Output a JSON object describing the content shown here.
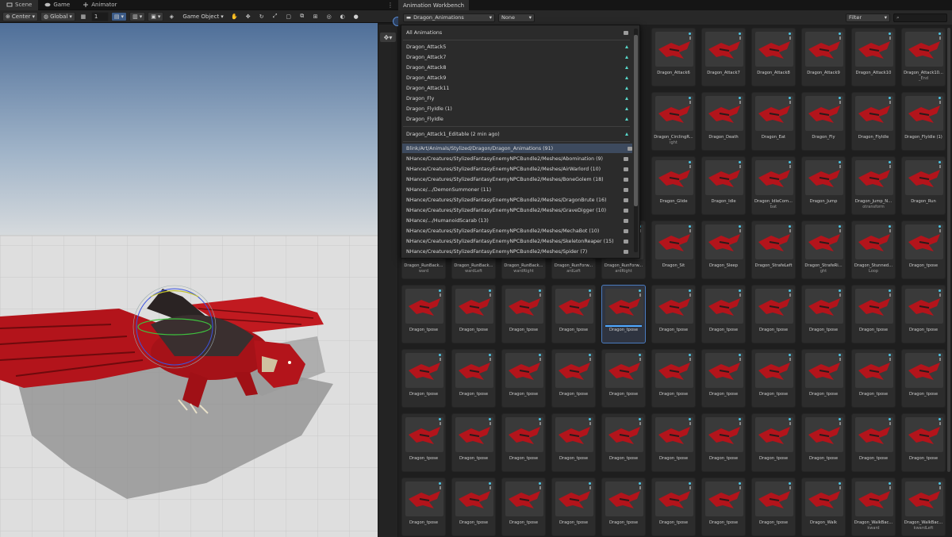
{
  "scene_tabs": [
    {
      "label": "Scene",
      "icon": "scene-icon"
    },
    {
      "label": "Game",
      "icon": "game-icon"
    },
    {
      "label": "Animator",
      "icon": "animator-icon"
    }
  ],
  "toolbar": {
    "pivot": "Center",
    "space": "Global",
    "snap": "1",
    "view_mode": "Game Object"
  },
  "workbench": {
    "title": "Animation Workbench",
    "folder_dropdown": "Dragon_Animations",
    "none_dropdown": "None",
    "filter_label": "Filter",
    "popup": {
      "all_animations": "All Animations",
      "recent": [
        "Dragon_Attack5",
        "Dragon_Attack7",
        "Dragon_Attack8",
        "Dragon_Attack9",
        "Dragon_Attack11",
        "Dragon_Fly",
        "Dragon_FlyIdle (1)",
        "Dragon_FlyIdle"
      ],
      "editable": "Dragon_Attack1_Editable  (2 min ago)",
      "folders": [
        "Blink/Art/Animals/Stylized/Dragon/Dragon_Animations  (91)",
        "NHance/Creatures/StylizedFantasyEnemyNPCBundle2/Meshes/Abomination  (9)",
        "NHance/Creatures/StylizedFantasyEnemyNPCBundle2/Meshes/AirWarlord  (10)",
        "NHance/Creatures/StylizedFantasyEnemyNPCBundle2/Meshes/BoneGolem  (18)",
        "NHance/.../DemonSummoner  (11)",
        "NHance/Creatures/StylizedFantasyEnemyNPCBundle2/Meshes/DragonBrute  (16)",
        "NHance/Creatures/StylizedFantasyEnemyNPCBundle2/Meshes/GraveDigger  (10)",
        "NHance/.../HumanoidScarab  (13)",
        "NHance/Creatures/StylizedFantasyEnemyNPCBundle2/Meshes/MechaBot  (10)",
        "NHance/Creatures/StylizedFantasyEnemyNPCBundle2/Meshes/SkeletonReaper  (15)",
        "NHance/Creatures/StylizedFantasyEnemyNPCBundle2/Meshes/Spider  (7)"
      ]
    },
    "rows": [
      [
        {
          "n": "Dragon_Attack6",
          "s": ""
        },
        {
          "n": "Dragon_Attack7",
          "s": ""
        },
        {
          "n": "Dragon_Attack8",
          "s": ""
        },
        {
          "n": "Dragon_Attack9",
          "s": ""
        },
        {
          "n": "Dragon_Attack10",
          "s": ""
        },
        {
          "n": "Dragon_Attack10...",
          "s": "_End"
        }
      ],
      [
        {
          "n": "Dragon_CirclingR...",
          "s": "ight"
        },
        {
          "n": "Dragon_Death",
          "s": ""
        },
        {
          "n": "Dragon_Eat",
          "s": ""
        },
        {
          "n": "Dragon_Fly",
          "s": ""
        },
        {
          "n": "Dragon_FlyIdle",
          "s": ""
        },
        {
          "n": "Dragon_FlyIdle (1)",
          "s": ""
        }
      ],
      [
        {
          "n": "Dragon_Glide",
          "s": ""
        },
        {
          "n": "Dragon_Idle",
          "s": ""
        },
        {
          "n": "Dragon_IdleCom...",
          "s": "bat"
        },
        {
          "n": "Dragon_Jump",
          "s": ""
        },
        {
          "n": "Dragon_Jump_N...",
          "s": "otransform"
        },
        {
          "n": "Dragon_Run",
          "s": ""
        }
      ],
      [
        {
          "n": "Dragon_RunBack...",
          "s": "ward"
        },
        {
          "n": "Dragon_RunBack...",
          "s": "wardLeft"
        },
        {
          "n": "Dragon_RunBack...",
          "s": "wardRight"
        },
        {
          "n": "Dragon_RunForw...",
          "s": "ardLeft"
        },
        {
          "n": "Dragon_RunForw...",
          "s": "ardRight"
        },
        {
          "n": "Dragon_Sit",
          "s": ""
        },
        {
          "n": "Dragon_Sleep",
          "s": ""
        },
        {
          "n": "Dragon_StrafeLeft",
          "s": ""
        },
        {
          "n": "Dragon_StrafeRi...",
          "s": "ght"
        },
        {
          "n": "Dragon_Stunned...",
          "s": "Loop"
        },
        {
          "n": "Dragon_tpose",
          "s": ""
        }
      ],
      [
        {
          "n": "Dragon_tpose",
          "s": ""
        },
        {
          "n": "Dragon_tpose",
          "s": ""
        },
        {
          "n": "Dragon_tpose",
          "s": ""
        },
        {
          "n": "Dragon_tpose",
          "s": ""
        },
        {
          "n": "Dragon_tpose",
          "s": ""
        },
        {
          "n": "Dragon_tpose",
          "s": ""
        },
        {
          "n": "Dragon_tpose",
          "s": ""
        },
        {
          "n": "Dragon_tpose",
          "s": ""
        },
        {
          "n": "Dragon_tpose",
          "s": ""
        },
        {
          "n": "Dragon_tpose",
          "s": ""
        },
        {
          "n": "Dragon_tpose",
          "s": ""
        }
      ],
      [
        {
          "n": "Dragon_tpose",
          "s": ""
        },
        {
          "n": "Dragon_tpose",
          "s": ""
        },
        {
          "n": "Dragon_tpose",
          "s": ""
        },
        {
          "n": "Dragon_tpose",
          "s": ""
        },
        {
          "n": "Dragon_tpose",
          "s": ""
        },
        {
          "n": "Dragon_tpose",
          "s": ""
        },
        {
          "n": "Dragon_tpose",
          "s": ""
        },
        {
          "n": "Dragon_tpose",
          "s": ""
        },
        {
          "n": "Dragon_tpose",
          "s": ""
        },
        {
          "n": "Dragon_tpose",
          "s": ""
        },
        {
          "n": "Dragon_tpose",
          "s": ""
        }
      ],
      [
        {
          "n": "Dragon_tpose",
          "s": ""
        },
        {
          "n": "Dragon_tpose",
          "s": ""
        },
        {
          "n": "Dragon_tpose",
          "s": ""
        },
        {
          "n": "Dragon_tpose",
          "s": ""
        },
        {
          "n": "Dragon_tpose",
          "s": ""
        },
        {
          "n": "Dragon_tpose",
          "s": ""
        },
        {
          "n": "Dragon_tpose",
          "s": ""
        },
        {
          "n": "Dragon_tpose",
          "s": ""
        },
        {
          "n": "Dragon_tpose",
          "s": ""
        },
        {
          "n": "Dragon_tpose",
          "s": ""
        },
        {
          "n": "Dragon_tpose",
          "s": ""
        }
      ],
      [
        {
          "n": "Dragon_tpose",
          "s": ""
        },
        {
          "n": "Dragon_tpose",
          "s": ""
        },
        {
          "n": "Dragon_tpose",
          "s": ""
        },
        {
          "n": "Dragon_tpose",
          "s": ""
        },
        {
          "n": "Dragon_tpose",
          "s": ""
        },
        {
          "n": "Dragon_tpose",
          "s": ""
        },
        {
          "n": "Dragon_tpose",
          "s": ""
        },
        {
          "n": "Dragon_tpose",
          "s": ""
        },
        {
          "n": "Dragon_Walk",
          "s": ""
        },
        {
          "n": "Dragon_WalkBac...",
          "s": "kward"
        },
        {
          "n": "Dragon_WalkBac...",
          "s": "kwardLeft"
        }
      ]
    ],
    "selected": "4.4"
  },
  "colors": {
    "accent": "#4ea8ff",
    "dragon": "#b3141b",
    "teal": "#57d6c9"
  }
}
